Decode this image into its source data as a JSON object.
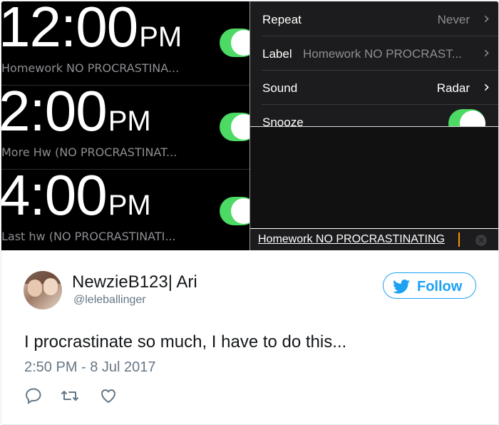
{
  "alarms": [
    {
      "time": "12:00",
      "ampm": "PM",
      "label": "Homework NO PROCRASTINA...",
      "enabled": true
    },
    {
      "time": "2:00",
      "ampm": "PM",
      "label": "More Hw (NO PROCRASTINAT...",
      "enabled": true
    },
    {
      "time": "4:00",
      "ampm": "PM",
      "label": "Last hw (NO PROCRASTINATI...",
      "enabled": true
    }
  ],
  "settings": {
    "repeat": {
      "key": "Repeat",
      "value": "Never"
    },
    "label": {
      "key": "Label",
      "value": "Homework NO PROCRAST..."
    },
    "sound": {
      "key": "Sound",
      "value": "Radar"
    },
    "snooze": {
      "key": "Snooze",
      "enabled": true
    }
  },
  "editor": {
    "value": "Homework NO PROCRASTINATING"
  },
  "tweet": {
    "display_name": "NewzieB123| Ari",
    "handle": "@leleballinger",
    "follow_label": "Follow",
    "text": "I procrastinate so much, I have to do this...",
    "timestamp": "2:50 PM - 8 Jul 2017"
  },
  "icons": [
    "chevron-right-icon",
    "clear-icon",
    "twitter-bird-icon",
    "reply-icon",
    "retweet-icon",
    "like-icon"
  ],
  "colors": {
    "toggle_on": "#4cd964",
    "twitter_blue": "#1da1f2",
    "caret": "#ff9500",
    "secondary_text": "#657786"
  }
}
